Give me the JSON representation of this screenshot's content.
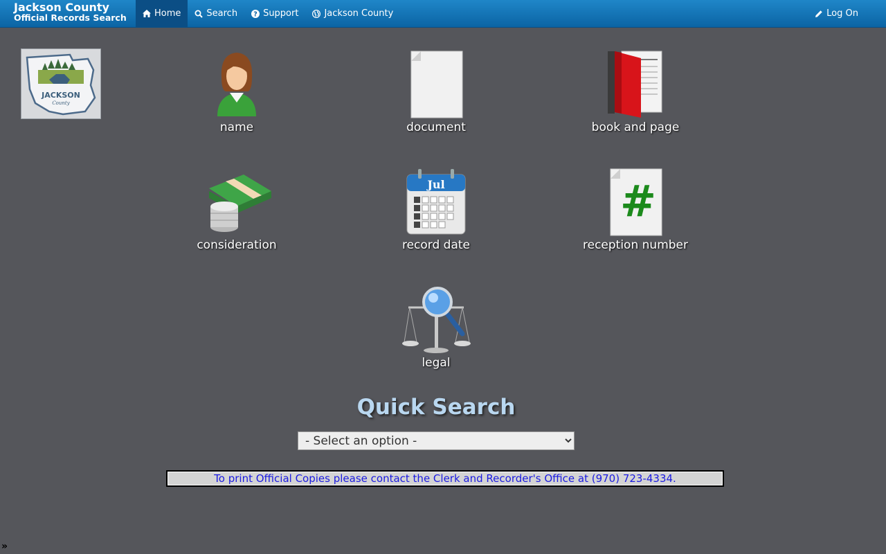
{
  "brand": {
    "line1": "Jackson County",
    "line2": "Official Records Search"
  },
  "nav": {
    "items": [
      {
        "label": "Home",
        "icon": "home-icon"
      },
      {
        "label": "Search",
        "icon": "search-icon"
      },
      {
        "label": "Support",
        "icon": "question-icon"
      },
      {
        "label": "Jackson County",
        "icon": "globe-icon"
      }
    ],
    "logon": {
      "label": "Log On",
      "icon": "pencil-icon"
    }
  },
  "logo": {
    "name": "jackson-county-logo",
    "text": "JACKSON",
    "sub": "County"
  },
  "tiles": [
    {
      "label": "name",
      "icon": "person-icon"
    },
    {
      "label": "document",
      "icon": "document-icon"
    },
    {
      "label": "book and page",
      "icon": "book-icon"
    },
    {
      "label": "consideration",
      "icon": "money-icon"
    },
    {
      "label": "record date",
      "icon": "calendar-icon"
    },
    {
      "label": "reception number",
      "icon": "hash-document-icon"
    },
    {
      "label": "legal",
      "icon": "scales-icon"
    }
  ],
  "calendar_month": "Jul",
  "quick_search": {
    "title": "Quick Search",
    "selected": "- Select an option -"
  },
  "notice": "To print Official Copies please contact the Clerk and Recorder's Office at (970) 723-4334.",
  "corner_glyph": "»",
  "colors": {
    "nav_bg": "#0b64a4",
    "page_bg": "#55565b",
    "notice_text": "#1a1ae0"
  }
}
